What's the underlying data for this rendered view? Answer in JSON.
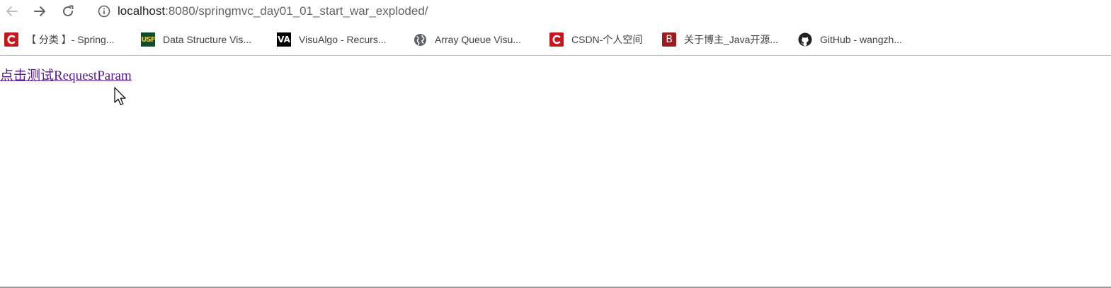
{
  "address_bar": {
    "host": "localhost",
    "path": ":8080/springmvc_day01_01_start_war_exploded/"
  },
  "bookmarks": [
    {
      "label": "【 分类 】- Spring...",
      "icon": "csdn-icon"
    },
    {
      "label": "Data Structure Vis...",
      "icon": "usf-icon",
      "icon_text": "USF"
    },
    {
      "label": "VisuAlgo - Recurs...",
      "icon": "visualgo-icon",
      "icon_text": "VA"
    },
    {
      "label": "Array Queue Visu...",
      "icon": "globe-icon"
    },
    {
      "label": "CSDN-个人空间",
      "icon": "csdn-icon"
    },
    {
      "label": "关于博主_Java开源...",
      "icon": "blog-b-icon",
      "icon_text": "B"
    },
    {
      "label": "GitHub - wangzh...",
      "icon": "github-icon"
    }
  ],
  "content": {
    "link_text": "点击测试RequestParam"
  },
  "colors": {
    "csdn_red": "#c8161d",
    "visited_link": "#551a8b"
  }
}
